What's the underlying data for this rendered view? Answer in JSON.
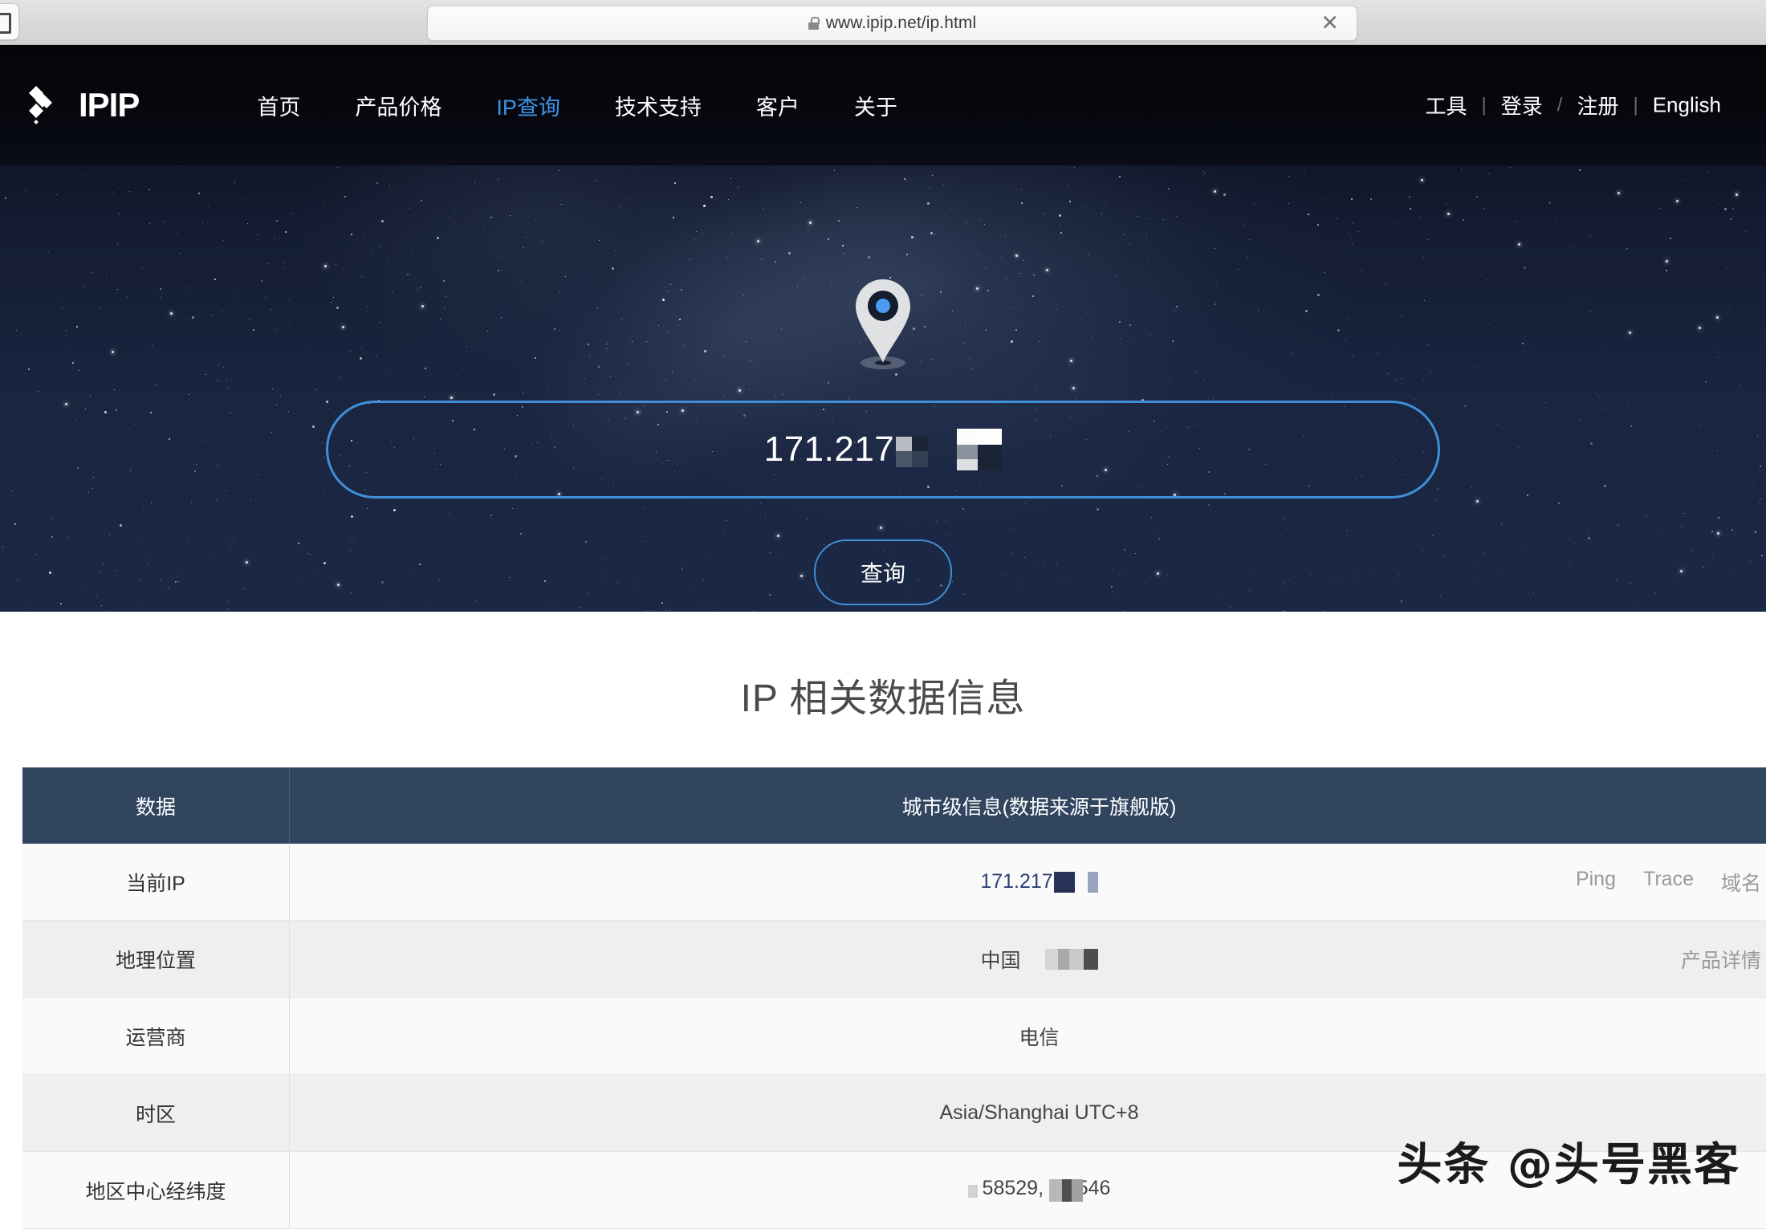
{
  "browser": {
    "url": "www.ipip.net/ip.html",
    "lock_icon": "lock-icon",
    "close_icon": "✕"
  },
  "nav": {
    "logo_text": "IPIP",
    "links": [
      {
        "label": "首页",
        "active": false
      },
      {
        "label": "产品价格",
        "active": false
      },
      {
        "label": "IP查询",
        "active": true
      },
      {
        "label": "技术支持",
        "active": false
      },
      {
        "label": "客户",
        "active": false
      },
      {
        "label": "关于",
        "active": false
      }
    ],
    "right": {
      "tools": "工具",
      "sep1": "|",
      "login": "登录",
      "sep2": "/",
      "register": "注册",
      "sep3": "|",
      "english": "English"
    }
  },
  "hero": {
    "pin_icon": "map-pin-icon",
    "ip_value_visible": "171.217",
    "ip_masked": true,
    "query_button": "查询"
  },
  "main": {
    "title": "IP 相关数据信息",
    "table": {
      "headers": [
        "数据",
        "城市级信息(数据来源于旗舰版)"
      ],
      "rows": [
        {
          "label": "当前IP",
          "value": "171.217",
          "value_masked": true,
          "is_link": true,
          "actions": [
            "Ping",
            "Trace",
            "域名"
          ]
        },
        {
          "label": "地理位置",
          "value": "中国",
          "value_masked": true,
          "is_link": false,
          "actions": [
            "产品详情"
          ]
        },
        {
          "label": "运营商",
          "value": "电信",
          "value_masked": false,
          "is_link": false,
          "actions": []
        },
        {
          "label": "时区",
          "value": "Asia/Shanghai UTC+8",
          "value_masked": false,
          "is_link": false,
          "actions": []
        },
        {
          "label": "地区中心经纬度",
          "value": "58529,  75546",
          "value_masked": true,
          "is_link": false,
          "actions": []
        }
      ]
    }
  },
  "watermark": {
    "text": "头条 @头号黑客"
  },
  "colors": {
    "accent_blue": "#3f8fd8",
    "nav_active": "#3b95e8",
    "table_header_bg": "#31455f",
    "ip_link": "#2a3f73"
  }
}
